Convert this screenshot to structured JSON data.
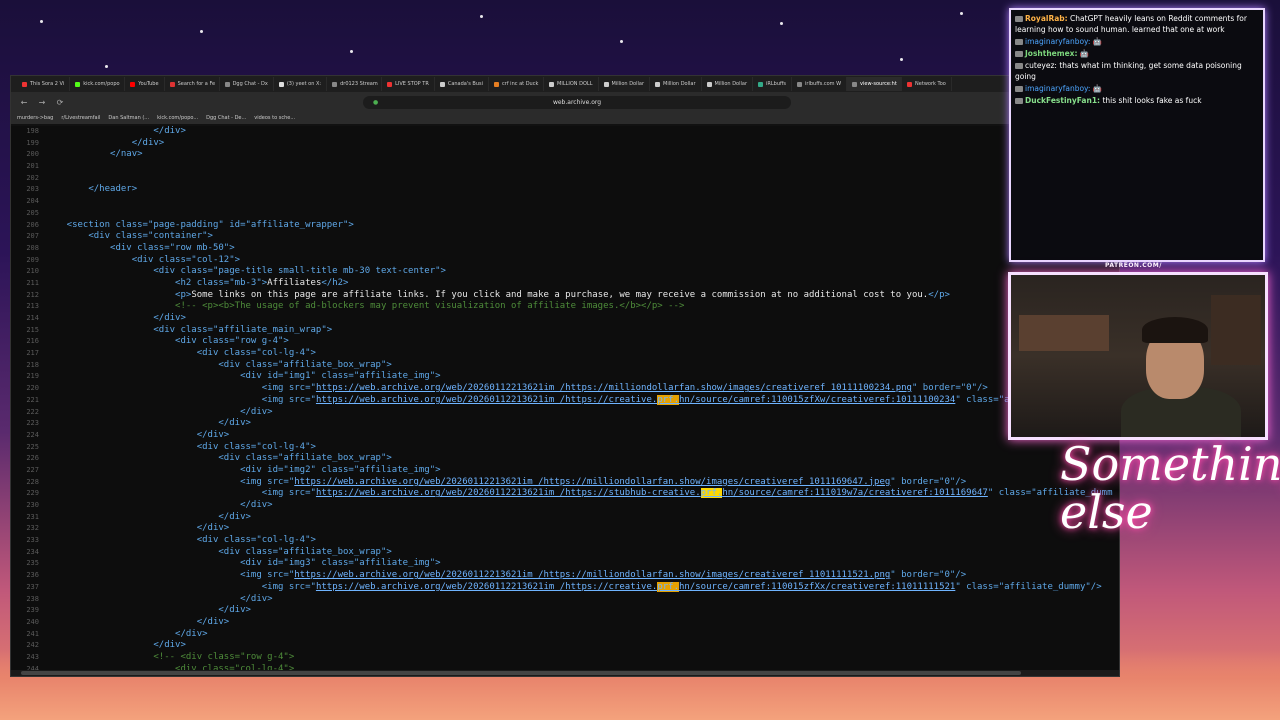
{
  "browser": {
    "tabs": [
      {
        "label": "This Sora 2 Vi",
        "color": "#e33"
      },
      {
        "label": "kick.com/popo",
        "color": "#53fc18"
      },
      {
        "label": "YouTube",
        "color": "#f00"
      },
      {
        "label": "Search for a Fe",
        "color": "#d33"
      },
      {
        "label": "Dgg Chat - Dx",
        "color": "#888"
      },
      {
        "label": "(3) yeet on X:",
        "color": "#ddd"
      },
      {
        "label": "dr0123 Stream",
        "color": "#888"
      },
      {
        "label": "LIVE STOP TR",
        "color": "#e33"
      },
      {
        "label": "Canada's Busi",
        "color": "#ccc"
      },
      {
        "label": "crf inc at Duck",
        "color": "#e67e22"
      },
      {
        "label": "MILLION DOLL",
        "color": "#ccc"
      },
      {
        "label": "Million Dollar",
        "color": "#ccc"
      },
      {
        "label": "Million Dollar",
        "color": "#ccc"
      },
      {
        "label": "Million Dollar",
        "color": "#ccc"
      },
      {
        "label": "iRLbuffs",
        "color": "#3a8"
      },
      {
        "label": "irlbuffs.com W",
        "color": "#888"
      },
      {
        "label": "view-source:ht",
        "color": "#888"
      },
      {
        "label": "Network Too",
        "color": "#e33"
      }
    ],
    "active_tab": 16,
    "url": "web.archive.org",
    "bookmarks": [
      "murders->bag",
      "r/Livestreamfail",
      "Dan Saltman (...",
      "kick.com/popo...",
      "Dgg Chat - De...",
      "videos to sche..."
    ]
  },
  "source": {
    "lines": [
      {
        "n": "198",
        "segs": [
          [
            "t",
            "                    </div>"
          ]
        ]
      },
      {
        "n": "199",
        "segs": [
          [
            "t",
            "                </div>"
          ]
        ]
      },
      {
        "n": "200",
        "segs": [
          [
            "t",
            "            </nav>"
          ]
        ]
      },
      {
        "n": "201",
        "segs": []
      },
      {
        "n": "202",
        "segs": []
      },
      {
        "n": "203",
        "segs": [
          [
            "t",
            "        </header>"
          ]
        ]
      },
      {
        "n": "204",
        "segs": []
      },
      {
        "n": "205",
        "segs": []
      },
      {
        "n": "206",
        "segs": [
          [
            "t",
            "    <section class=\"page-padding\" id=\"affiliate_wrapper\">"
          ]
        ]
      },
      {
        "n": "207",
        "segs": [
          [
            "t",
            "        <div class=\"container\">"
          ]
        ]
      },
      {
        "n": "208",
        "segs": [
          [
            "t",
            "            <div class=\"row mb-50\">"
          ]
        ]
      },
      {
        "n": "209",
        "segs": [
          [
            "t",
            "                <div class=\"col-12\">"
          ]
        ]
      },
      {
        "n": "210",
        "segs": [
          [
            "t",
            "                    <div class=\"page-title small-title mb-30 text-center\">"
          ]
        ]
      },
      {
        "n": "211",
        "segs": [
          [
            "t",
            "                        <h2 class=\"mb-3\">"
          ],
          [
            "w",
            "Affiliates"
          ],
          [
            "t",
            "</h2>"
          ]
        ]
      },
      {
        "n": "212",
        "segs": [
          [
            "t",
            "                        <p>"
          ],
          [
            "w",
            "Some links on this page are affiliate links. If you click and make a purchase, we may receive a commission at no additional cost to you."
          ],
          [
            "t",
            "</p>"
          ]
        ]
      },
      {
        "n": "213",
        "segs": [
          [
            "c",
            "                        <!-- <p><b>The usage of ad-blockers may prevent visualization of affiliate images.</b></p> -->"
          ]
        ]
      },
      {
        "n": "214",
        "segs": [
          [
            "t",
            "                    </div>"
          ]
        ]
      },
      {
        "n": "215",
        "segs": [
          [
            "t",
            "                    <div class=\"affiliate_main_wrap\">"
          ]
        ]
      },
      {
        "n": "216",
        "segs": [
          [
            "t",
            "                        <div class=\"row g-4\">"
          ]
        ]
      },
      {
        "n": "217",
        "segs": [
          [
            "t",
            "                            <div class=\"col-lg-4\">"
          ]
        ]
      },
      {
        "n": "218",
        "segs": [
          [
            "t",
            "                                <div class=\"affiliate_box_wrap\">"
          ]
        ]
      },
      {
        "n": "219",
        "segs": [
          [
            "t",
            "                                    <div id=\"img1\" class=\"affiliate_img\">"
          ]
        ]
      },
      {
        "n": "220",
        "segs": [
          [
            "t",
            "                                        <img src=\""
          ],
          [
            "l",
            "https://web.archive.org/web/20260112213621im_/https://milliondollarfan.show/images/creativeref_10111100234.png"
          ],
          [
            "t",
            "\" border=\"0\"/>"
          ]
        ]
      },
      {
        "n": "221",
        "segs": [
          [
            "t",
            "                                        <img src=\""
          ],
          [
            "l",
            "https://web.archive.org/web/20260112213621im_/https://creative."
          ],
          [
            "h",
            "prf."
          ],
          [
            "l",
            "hn/source/camref:110015zfXw/creativeref:10111100234"
          ],
          [
            "t",
            "\" class=\"af"
          ]
        ]
      },
      {
        "n": "222",
        "segs": [
          [
            "t",
            "                                    </div>"
          ]
        ]
      },
      {
        "n": "223",
        "segs": [
          [
            "t",
            "                                </div>"
          ]
        ]
      },
      {
        "n": "224",
        "segs": [
          [
            "t",
            "                            </div>"
          ]
        ]
      },
      {
        "n": "225",
        "segs": [
          [
            "t",
            "                            <div class=\"col-lg-4\">"
          ]
        ]
      },
      {
        "n": "226",
        "segs": [
          [
            "t",
            "                                <div class=\"affiliate_box_wrap\">"
          ]
        ]
      },
      {
        "n": "227",
        "segs": [
          [
            "t",
            "                                    <div id=\"img2\" class=\"affiliate_img\">"
          ]
        ]
      },
      {
        "n": "228",
        "segs": [
          [
            "t",
            "                                    <img src=\""
          ],
          [
            "l",
            "https://web.archive.org/web/20260112213621im_/https://milliondollarfan.show/images/creativeref_1011169647.jpeg"
          ],
          [
            "t",
            "\" border=\"0\"/>"
          ]
        ]
      },
      {
        "n": "229",
        "segs": [
          [
            "t",
            "                                        <img src=\""
          ],
          [
            "l",
            "https://web.archive.org/web/20260112213621im_/https://stubhub-creative."
          ],
          [
            "h2",
            "prf."
          ],
          [
            "l",
            "hn/source/camref:111019w7a/creativeref:1011169647"
          ],
          [
            "t",
            "\" class=\"affiliate_dumm"
          ]
        ]
      },
      {
        "n": "230",
        "segs": [
          [
            "t",
            "                                    </div>"
          ]
        ]
      },
      {
        "n": "231",
        "segs": [
          [
            "t",
            "                                </div>"
          ]
        ]
      },
      {
        "n": "232",
        "segs": [
          [
            "t",
            "                            </div>"
          ]
        ]
      },
      {
        "n": "233",
        "segs": [
          [
            "t",
            "                            <div class=\"col-lg-4\">"
          ]
        ]
      },
      {
        "n": "234",
        "segs": [
          [
            "t",
            "                                <div class=\"affiliate_box_wrap\">"
          ]
        ]
      },
      {
        "n": "235",
        "segs": [
          [
            "t",
            "                                    <div id=\"img3\" class=\"affiliate_img\">"
          ]
        ]
      },
      {
        "n": "236",
        "segs": [
          [
            "t",
            "                                    <img src=\""
          ],
          [
            "l",
            "https://web.archive.org/web/20260112213621im_/https://milliondollarfan.show/images/creativeref_11011111521.png"
          ],
          [
            "t",
            "\" border=\"0\"/>"
          ]
        ]
      },
      {
        "n": "237",
        "segs": [
          [
            "t",
            "                                        <img src=\""
          ],
          [
            "l",
            "https://web.archive.org/web/20260112213621im_/https://creative."
          ],
          [
            "h",
            "prf."
          ],
          [
            "l",
            "hn/source/camref:110015zfXx/creativeref:11011111521"
          ],
          [
            "t",
            "\" class=\"affiliate_dummy\"/>"
          ]
        ]
      },
      {
        "n": "238",
        "segs": [
          [
            "t",
            "                                    </div>"
          ]
        ]
      },
      {
        "n": "239",
        "segs": [
          [
            "t",
            "                                </div>"
          ]
        ]
      },
      {
        "n": "240",
        "segs": [
          [
            "t",
            "                            </div>"
          ]
        ]
      },
      {
        "n": "241",
        "segs": [
          [
            "t",
            "                        </div>"
          ]
        ]
      },
      {
        "n": "242",
        "segs": [
          [
            "t",
            "                    </div>"
          ]
        ]
      },
      {
        "n": "243",
        "segs": [
          [
            "c",
            "                    <!-- <div class=\"row g-4\">"
          ]
        ]
      },
      {
        "n": "244",
        "segs": [
          [
            "c",
            "                        <div class=\"col-lg-4\">"
          ]
        ]
      }
    ]
  },
  "chat": {
    "messages": [
      {
        "user": "RoyalRab",
        "cls": "user1",
        "text": "ChatGPT heavily leans on Reddit comments for learning how to sound human. learned that one at work"
      },
      {
        "user": "imaginaryfanboy",
        "cls": "user2",
        "text": "🤖"
      },
      {
        "user": "Joshthemex",
        "cls": "user3",
        "text": "🤖"
      },
      {
        "user": "cuteyez",
        "cls": "plain",
        "text": "thats what im thinking, get some data poisoning going"
      },
      {
        "user": "imaginaryfanboy",
        "cls": "user2",
        "text": "🤖"
      },
      {
        "user": "DuckFestinyFan1",
        "cls": "user4",
        "text": "this shit looks fake as fuck"
      }
    ]
  },
  "overlay": {
    "patreon_label": "PATREON.COM/",
    "signature": "Something else"
  }
}
